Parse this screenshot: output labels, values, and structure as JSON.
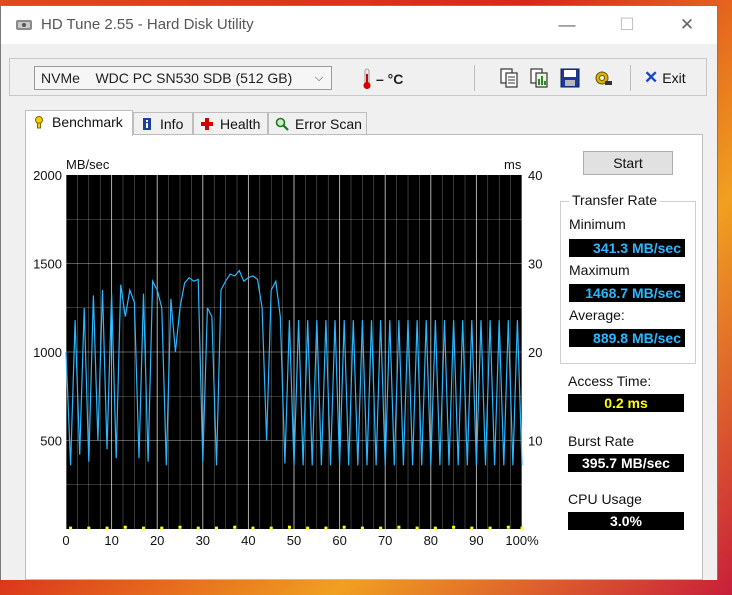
{
  "window": {
    "title": "HD Tune 2.55 - Hard Disk Utility",
    "minimize_glyph": "—",
    "maximize_glyph": "☐",
    "close_glyph": "✕"
  },
  "toolbar": {
    "drive_label": "NVMe    WDC PC SN530 SDB (512 GB)",
    "temperature": "– °C",
    "icons": [
      "copy-text-icon",
      "copy-info-icon",
      "save-icon",
      "options-icon"
    ],
    "exit_label": "Exit"
  },
  "tabs": [
    {
      "label": "Benchmark",
      "icon": "benchmark-icon",
      "active": true
    },
    {
      "label": "Info",
      "icon": "info-icon",
      "active": false
    },
    {
      "label": "Health",
      "icon": "health-icon",
      "active": false
    },
    {
      "label": "Error Scan",
      "icon": "error-scan-icon",
      "active": false
    }
  ],
  "actions": {
    "start_label": "Start"
  },
  "stats": {
    "transfer_rate_title": "Transfer Rate",
    "minimum_label": "Minimum",
    "minimum_value": "341.3 MB/sec",
    "maximum_label": "Maximum",
    "maximum_value": "1468.7 MB/sec",
    "average_label": "Average:",
    "average_value": "889.8 MB/sec",
    "access_time_label": "Access Time:",
    "access_time_value": "0.2 ms",
    "burst_rate_label": "Burst Rate",
    "burst_rate_value": "395.7 MB/sec",
    "cpu_usage_label": "CPU Usage",
    "cpu_usage_value": "3.0%"
  },
  "colors": {
    "plot_bg": "#000000",
    "grid": "#ffffff",
    "transfer_line": "#29b7ff",
    "access_points": "#ffff00"
  },
  "chart_data": {
    "type": "line",
    "ylabel": "MB/sec",
    "y2label": "ms",
    "ylim": [
      0,
      2000
    ],
    "y2lim": [
      0,
      40
    ],
    "xlim": [
      0,
      100
    ],
    "x_ticks": [
      "0",
      "10",
      "20",
      "30",
      "40",
      "50",
      "60",
      "70",
      "80",
      "90",
      "100%"
    ],
    "y_ticks": [
      "500",
      "1000",
      "1500",
      "2000"
    ],
    "y2_ticks": [
      "10",
      "20",
      "30",
      "40"
    ],
    "grid": true,
    "series": [
      {
        "x": [
          0,
          1,
          2,
          3,
          4,
          5,
          6,
          7,
          8,
          9,
          10,
          11,
          12,
          13,
          14,
          15,
          16,
          17,
          18,
          19,
          20,
          21,
          22,
          23,
          24,
          25,
          26,
          27,
          28,
          29,
          30,
          31,
          32,
          33,
          34,
          35,
          36,
          37,
          38,
          39,
          40,
          41,
          42,
          43,
          44,
          45,
          46,
          47,
          48,
          49,
          50,
          51,
          52,
          53,
          54,
          55,
          56,
          57,
          58,
          59,
          60,
          61,
          62,
          63,
          64,
          65,
          66,
          67,
          68,
          69,
          70,
          71,
          72,
          73,
          74,
          75,
          76,
          77,
          78,
          79,
          80,
          81,
          82,
          83,
          84,
          85,
          86,
          87,
          88,
          89,
          90,
          91,
          92,
          93,
          94,
          95,
          96,
          97,
          98,
          99,
          100
        ],
        "values": [
          1000,
          360,
          1180,
          420,
          1250,
          380,
          1320,
          500,
          1350,
          450,
          1330,
          400,
          1380,
          1200,
          1350,
          1280,
          400,
          1330,
          380,
          1400,
          1350,
          1250,
          360,
          1300,
          1000,
          1250,
          1390,
          1420,
          1400,
          1410,
          380,
          1250,
          1200,
          360,
          1350,
          1400,
          1440,
          1430,
          1460,
          1400,
          1420,
          1430,
          1410,
          1250,
          500,
          1350,
          1400,
          1200,
          370,
          1180,
          360,
          1180,
          360,
          1180,
          360,
          1180,
          360,
          1180,
          360,
          1180,
          360,
          1180,
          360,
          1180,
          360,
          1180,
          360,
          1180,
          360,
          1180,
          360,
          1180,
          360,
          1180,
          360,
          1180,
          360,
          1180,
          360,
          1180,
          360,
          1180,
          360,
          1180,
          360,
          1180,
          360,
          1180,
          360,
          1180,
          360,
          1180,
          360,
          1180,
          360,
          1180,
          360,
          1180,
          360,
          1180,
          360
        ]
      },
      {
        "x": [
          1,
          5,
          9,
          13,
          17,
          21,
          25,
          29,
          33,
          37,
          41,
          45,
          49,
          53,
          57,
          61,
          65,
          69,
          73,
          77,
          81,
          85,
          89,
          93,
          97,
          100
        ],
        "values": [
          0.1,
          0.1,
          0.1,
          0.2,
          0.1,
          0.1,
          0.2,
          0.1,
          0.1,
          0.2,
          0.1,
          0.1,
          0.2,
          0.1,
          0.1,
          0.2,
          0.1,
          0.1,
          0.2,
          0.1,
          0.1,
          0.2,
          0.1,
          0.1,
          0.2,
          0.1
        ],
        "axis": "y2"
      }
    ]
  }
}
